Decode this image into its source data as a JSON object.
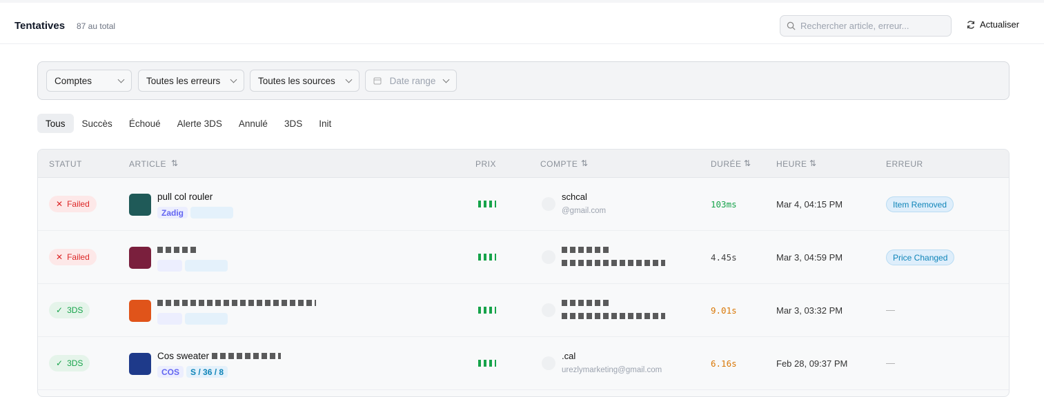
{
  "header": {
    "title": "Tentatives",
    "count": "87 au total",
    "search_placeholder": "Rechercher article, erreur...",
    "refresh": "Actualiser"
  },
  "filters": {
    "accounts": "Comptes",
    "errors": "Toutes les erreurs",
    "sources": "Toutes les sources",
    "date": "Date range"
  },
  "tabs": [
    "Tous",
    "Succès",
    "Échoué",
    "Alerte 3DS",
    "Annulé",
    "3DS",
    "Init"
  ],
  "columns": {
    "status": "STATUT",
    "article": "ARTICLE",
    "price": "PRIX",
    "account": "COMPTE",
    "duration": "DURÉE",
    "time": "HEURE",
    "error": "ERREUR"
  },
  "rows": [
    {
      "status": "Failed",
      "status_type": "fail",
      "article": "pull col rouler",
      "tag1": "Zadig",
      "tag2": "",
      "account": "schcal",
      "email": "@gmail.com",
      "duration": "103ms",
      "duration_color": "#16a34a",
      "time": "Mar 4, 04:15 PM",
      "error": "Item Removed",
      "thumb": "#1f5a58"
    },
    {
      "status": "Failed",
      "status_type": "fail",
      "article": "",
      "tag1": "",
      "tag2": "",
      "account": "",
      "email": "",
      "duration": "4.45s",
      "duration_color": "#444444",
      "time": "Mar 3, 04:59 PM",
      "error": "Price Changed",
      "thumb": "#7a1f3d"
    },
    {
      "status": "3DS",
      "status_type": "3ds",
      "article": "",
      "tag1": "",
      "tag2": "",
      "account": "",
      "email": "",
      "duration": "9.01s",
      "duration_color": "#d97706",
      "time": "Mar 3, 03:32 PM",
      "error": "—",
      "thumb": "#e0541a"
    },
    {
      "status": "3DS",
      "status_type": "3ds",
      "article": "Cos sweater",
      "tag1": "COS",
      "tag2": "S / 36 / 8",
      "account": ".cal",
      "email": "urezlymarketing@gmail.com",
      "duration": "6.16s",
      "duration_color": "#d97706",
      "time": "Feb 28, 09:37 PM",
      "error": "—",
      "thumb": "#1e3a8a"
    }
  ]
}
